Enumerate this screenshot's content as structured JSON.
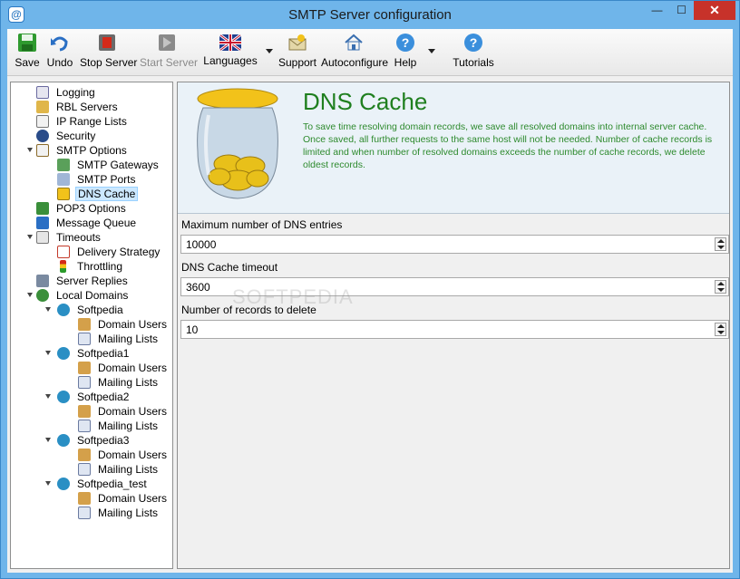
{
  "window": {
    "title": "SMTP Server configuration",
    "app_icon_glyph": "@",
    "minimize_glyph": "—",
    "maximize_glyph": "☐",
    "close_glyph": "✕"
  },
  "toolbar": {
    "buttons": [
      {
        "label": "Save",
        "icon": "floppy-disk-icon"
      },
      {
        "label": "Undo",
        "icon": "undo-arrow-icon"
      },
      {
        "label": "Stop Server",
        "icon": "stop-server-icon"
      },
      {
        "label": "Start Server",
        "icon": "start-server-icon",
        "disabled": true
      },
      {
        "label": "Languages",
        "icon": "uk-flag-icon"
      },
      {
        "label": "Support",
        "icon": "support-envelope-icon"
      },
      {
        "label": "Autoconfigure",
        "icon": "house-icon"
      },
      {
        "label": "Help",
        "icon": "help-question-icon"
      },
      {
        "label": "Tutorials",
        "icon": "tutorials-question-icon"
      }
    ]
  },
  "tree": {
    "items": [
      {
        "label": "Logging",
        "icon": "log-icon"
      },
      {
        "label": "RBL Servers",
        "icon": "rbl-icon"
      },
      {
        "label": "IP Range Lists",
        "icon": "ip-range-icon"
      },
      {
        "label": "Security",
        "icon": "security-officer-icon"
      },
      {
        "label": "SMTP Options",
        "icon": "smtp-options-icon"
      },
      {
        "label": "SMTP Gateways",
        "icon": "gateway-icon"
      },
      {
        "label": "SMTP Ports",
        "icon": "ports-icon"
      },
      {
        "label": "DNS Cache",
        "icon": "dns-cache-icon"
      },
      {
        "label": "POP3 Options",
        "icon": "pop3-icon"
      },
      {
        "label": "Message Queue",
        "icon": "queue-icon"
      },
      {
        "label": "Timeouts",
        "icon": "timeouts-icon"
      },
      {
        "label": "Delivery Strategy",
        "icon": "calendar-icon"
      },
      {
        "label": "Throttling",
        "icon": "traffic-light-icon"
      },
      {
        "label": "Server Replies",
        "icon": "server-icon"
      },
      {
        "label": "Local Domains",
        "icon": "local-domains-icon"
      },
      {
        "label": "Softpedia",
        "icon": "globe-icon"
      },
      {
        "label": "Domain Users",
        "icon": "users-icon"
      },
      {
        "label": "Mailing Lists",
        "icon": "list-icon"
      },
      {
        "label": "Softpedia1",
        "icon": "globe-icon"
      },
      {
        "label": "Domain Users",
        "icon": "users-icon"
      },
      {
        "label": "Mailing Lists",
        "icon": "list-icon"
      },
      {
        "label": "Softpedia2",
        "icon": "globe-icon"
      },
      {
        "label": "Domain Users",
        "icon": "users-icon"
      },
      {
        "label": "Mailing Lists",
        "icon": "list-icon"
      },
      {
        "label": "Softpedia3",
        "icon": "globe-icon"
      },
      {
        "label": "Domain Users",
        "icon": "users-icon"
      },
      {
        "label": "Mailing Lists",
        "icon": "list-icon"
      },
      {
        "label": "Softpedia_test",
        "icon": "globe-icon"
      },
      {
        "label": "Domain Users",
        "icon": "users-icon"
      },
      {
        "label": "Mailing Lists",
        "icon": "list-icon"
      }
    ]
  },
  "page": {
    "title": "DNS Cache",
    "description": "To save time resolving domain records, we save all resolved domains into internal server cache. Once saved, all further requests to the same host will not be needed. Number of cache records is limited and when number of resolved domains exceeds the number of cache records, we delete oldest records.",
    "fields": [
      {
        "label": "Maximum number of DNS entries",
        "value": "10000"
      },
      {
        "label": "DNS Cache timeout",
        "value": "3600"
      },
      {
        "label": "Number of records to delete",
        "value": "10"
      }
    ],
    "watermark": "SOFTPEDIA"
  },
  "colors": {
    "accent_green": "#1f7f1f",
    "titlebar_blue": "#6fb5ea",
    "selection": "#cce8ff"
  }
}
